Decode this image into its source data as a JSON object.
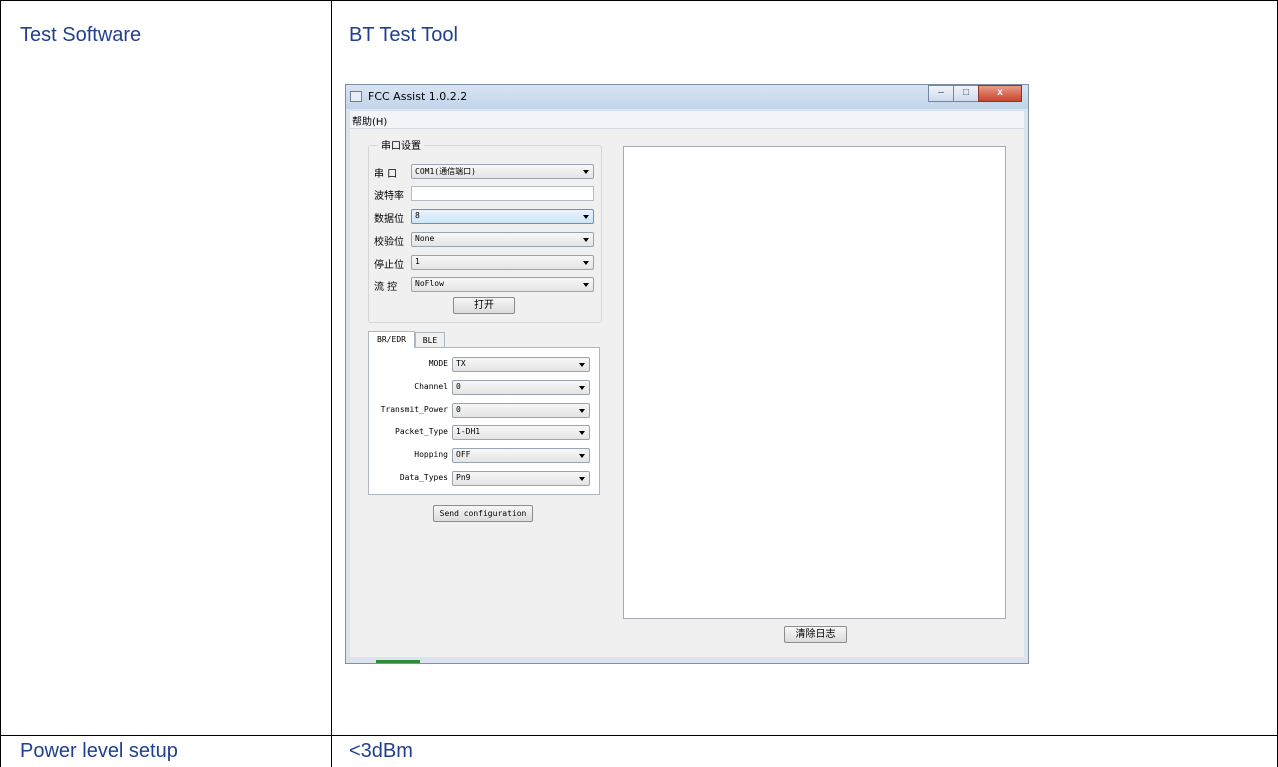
{
  "document": {
    "rows": [
      {
        "label": "Test Software",
        "value": "BT Test Tool"
      },
      {
        "label": "Power level setup",
        "value": "<3dBm"
      }
    ]
  },
  "app": {
    "title": "FCC Assist 1.0.2.2",
    "window_buttons": {
      "minimize": "–",
      "maximize": "□",
      "close": "x"
    },
    "menu": {
      "help": "帮助(H)"
    },
    "serial": {
      "group_title": "串口设置",
      "port_label": "串  口",
      "port_value": "COM1(通信端口)",
      "baud_label": "波特率",
      "baud_value": "",
      "databits_label": "数据位",
      "databits_value": "8",
      "parity_label": "校验位",
      "parity_value": "None",
      "stopbits_label": "停止位",
      "stopbits_value": "1",
      "flow_label": "流  控",
      "flow_value": "NoFlow",
      "open_button": "打开"
    },
    "tabs": [
      {
        "label": "BR/EDR",
        "active": true
      },
      {
        "label": "BLE",
        "active": false
      }
    ],
    "bredr": {
      "mode_label": "MODE",
      "mode_value": "TX",
      "channel_label": "Channel",
      "channel_value": "0",
      "power_label": "Transmit_Power",
      "power_value": "0",
      "packet_label": "Packet_Type",
      "packet_value": "1-DH1",
      "hopping_label": "Hopping",
      "hopping_value": "OFF",
      "datatypes_label": "Data_Types",
      "datatypes_value": "Pn9"
    },
    "send_button": "Send configuration",
    "clear_log_button": "清除日志"
  },
  "colors": {
    "doc_text": "#1f3f8f",
    "title_bar": "#c2d4ea",
    "close_button": "#c7452f",
    "focused_combo": "#cde6f8"
  }
}
